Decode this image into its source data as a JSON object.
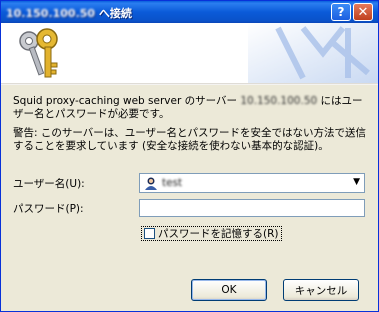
{
  "window": {
    "title_host": "10.150.100.50",
    "title_suffix": "へ接続",
    "help_glyph": "?",
    "close_glyph": "✕"
  },
  "banner": {
    "icon": "keys-icon"
  },
  "message": {
    "prefix": "Squid proxy-caching web server のサーバー ",
    "server_blurred": "10.150.100.50",
    "suffix": " にはユーザー名とパスワードが必要です。"
  },
  "warning": {
    "text": "警告: このサーバーは、ユーザー名とパスワードを安全ではない方法で送信することを要求しています (安全な接続を使わない基本的な認証)。"
  },
  "form": {
    "username_label": "ユーザー名(U):",
    "username_value": "test",
    "password_label": "パスワード(P):",
    "password_value": "",
    "remember_label": "パスワードを記憶する(R)",
    "remember_checked": false
  },
  "buttons": {
    "ok": "OK",
    "cancel": "キャンセル"
  }
}
